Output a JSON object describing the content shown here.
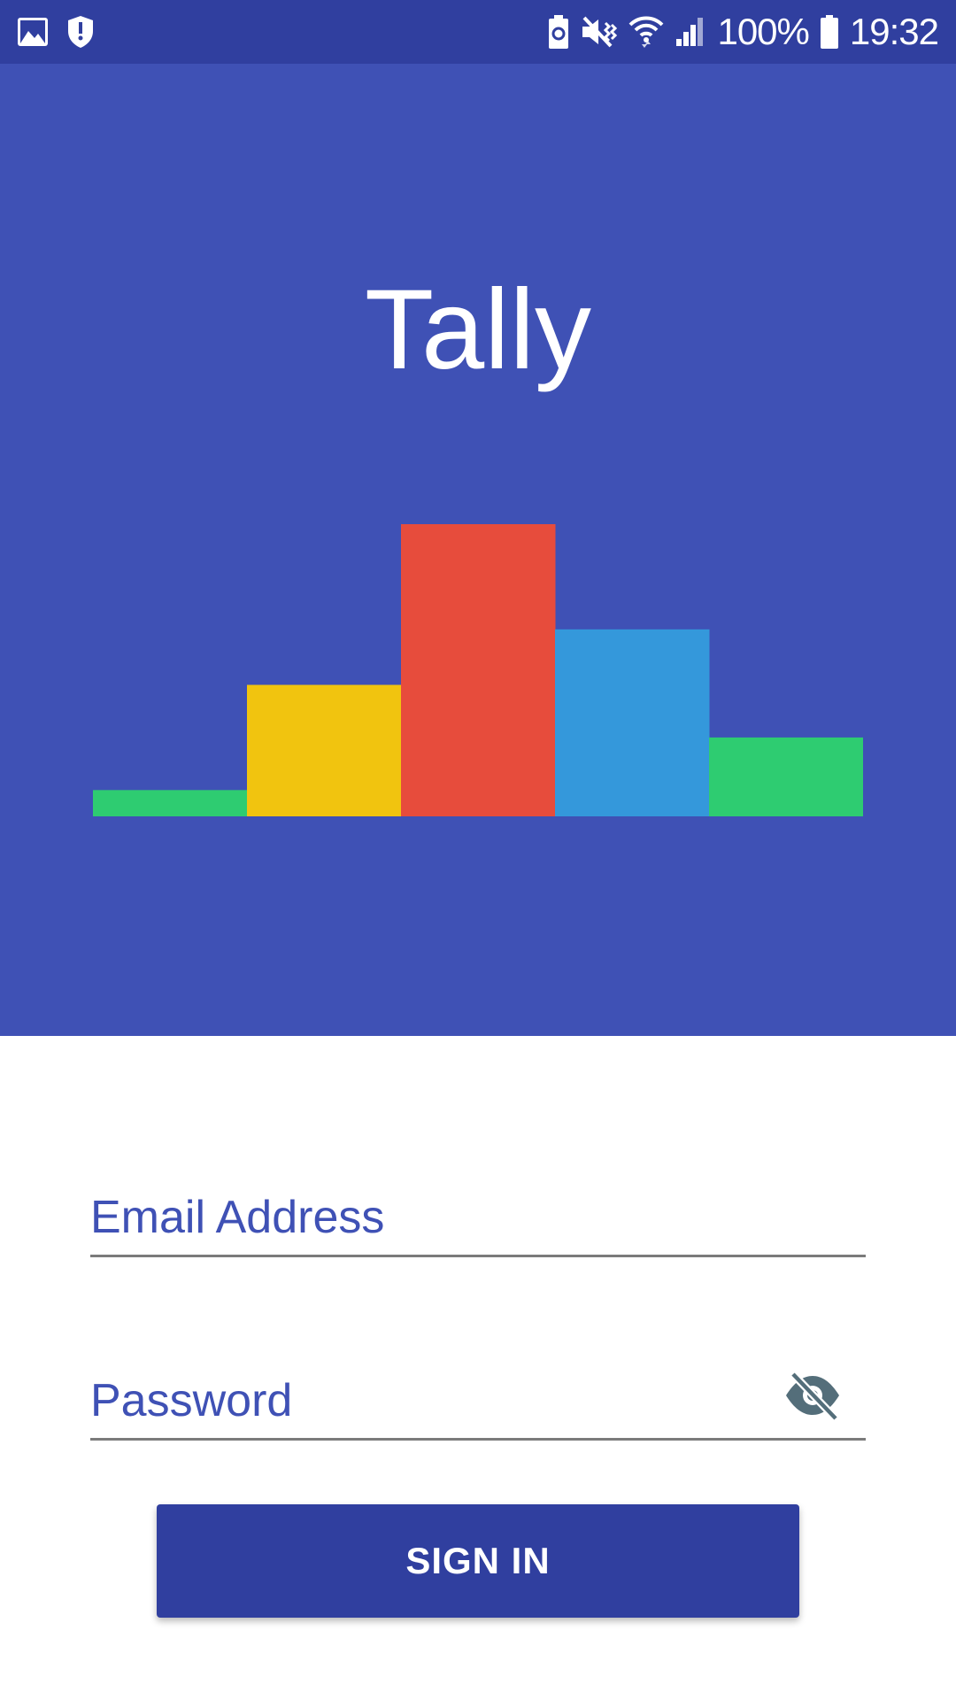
{
  "status_bar": {
    "left_icons": [
      "image-icon",
      "shield-icon"
    ],
    "right_icons": [
      "battery-saver-icon",
      "vibrate-mute-icon",
      "wifi-icon",
      "signal-icon",
      "battery-icon"
    ],
    "battery_percent": "100%",
    "time": "19:32"
  },
  "hero": {
    "app_name": "Tally",
    "background_color": "#3F51B5"
  },
  "chart_data": {
    "type": "bar",
    "values": [
      0.09,
      0.45,
      1.0,
      0.64,
      0.27
    ],
    "colors": [
      "#2ECC71",
      "#F1C40F",
      "#E74C3C",
      "#3498DB",
      "#2ECC71"
    ],
    "title": "",
    "xlabel": "",
    "ylabel": "",
    "ylim": [
      0,
      1
    ]
  },
  "form": {
    "email_label": "Email Address",
    "password_label": "Password",
    "password_toggle_icon": "visibility-off-icon"
  },
  "actions": {
    "sign_in_label": "SIGN IN",
    "button_color": "#303F9F"
  }
}
